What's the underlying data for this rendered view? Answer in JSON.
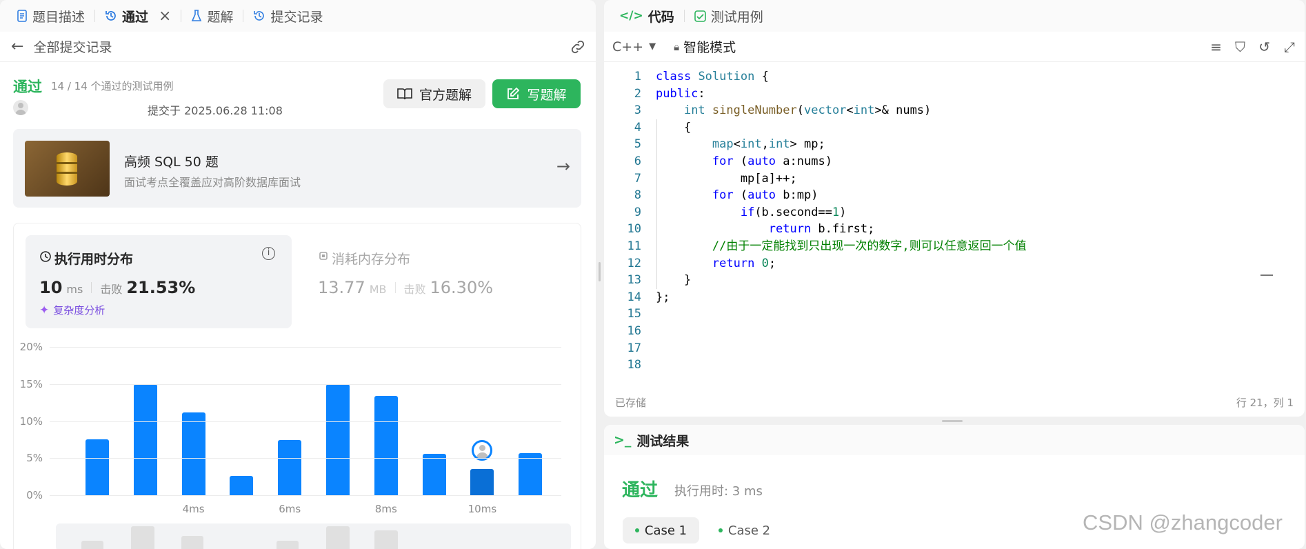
{
  "left_tabs": [
    {
      "label": "题目描述"
    },
    {
      "label": "通过"
    },
    {
      "label": "题解"
    },
    {
      "label": "提交记录"
    }
  ],
  "back_label": "全部提交记录",
  "submission": {
    "status": "通过",
    "cases": "14 / 14 个通过的测试用例",
    "submitted_at": "提交于 2025.06.28 11:08",
    "official_btn": "官方题解",
    "write_btn": "写题解"
  },
  "promo": {
    "title": "高频 SQL 50 题",
    "subtitle": "面试考点全覆盖应对高阶数据库面试"
  },
  "stats": {
    "runtime_title": "执行用时分布",
    "runtime_value": "10",
    "runtime_unit": "ms",
    "beat_label": "击败",
    "runtime_beat": "21.53%",
    "complexity": "复杂度分析",
    "memory_title": "消耗内存分布",
    "memory_value": "13.77",
    "memory_unit": "MB",
    "memory_beat": "16.30%"
  },
  "chart_data": {
    "type": "bar",
    "ylabels": [
      "20%",
      "15%",
      "10%",
      "5%",
      "0%"
    ],
    "ylim": [
      0,
      20
    ],
    "values": [
      7.5,
      15,
      11.2,
      2.6,
      7.4,
      15,
      13.4,
      5.6,
      3.5,
      5.7
    ],
    "xtick_labels": [
      "4ms",
      "6ms",
      "8ms",
      "10ms"
    ],
    "xtick_positions": [
      2,
      4,
      6,
      8
    ],
    "highlight_index": 8,
    "color": "#0a84ff"
  },
  "editor": {
    "tabs": [
      {
        "label": "代码"
      },
      {
        "label": "测试用例"
      }
    ],
    "language": "C++",
    "mode": "智能模式",
    "saved": "已存储",
    "cursor": "行 21，列 1",
    "code": [
      "class Solution {",
      "public:",
      "    int singleNumber(vector<int>& nums)",
      "    {",
      "        map<int,int> mp;",
      "        for (auto a:nums)",
      "            mp[a]++;",
      "        for (auto b:mp)",
      "            if(b.second==1)",
      "                return b.first;",
      "        //由于一定能找到只出现一次的数字,则可以任意返回一个值",
      "        return 0;",
      "    }",
      "};",
      "",
      "",
      "",
      ""
    ]
  },
  "result": {
    "title": "测试结果",
    "status": "通过",
    "runtime": "执行用时: 3 ms",
    "cases": [
      "Case 1",
      "Case 2"
    ]
  },
  "watermark": "CSDN @zhangcoder"
}
